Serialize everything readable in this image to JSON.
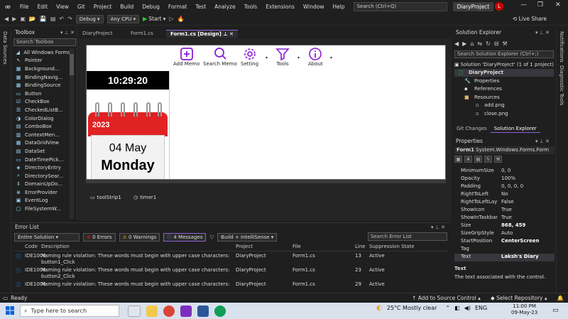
{
  "menu": {
    "items": [
      "File",
      "Edit",
      "View",
      "Git",
      "Project",
      "Build",
      "Debug",
      "Format",
      "Test",
      "Analyze",
      "Tools",
      "Extensions",
      "Window",
      "Help"
    ],
    "search_placeholder": "Search (Ctrl+Q)",
    "project_name": "DiaryProject",
    "avatar_letter": "L"
  },
  "toolbar": {
    "config": "Debug",
    "platform": "Any CPU",
    "start_label": "Start",
    "live_share": "Live Share"
  },
  "left_strip": {
    "label": "Data Sources"
  },
  "toolbox": {
    "title": "Toolbox",
    "search_placeholder": "Search Toolbox",
    "group": "All Windows Forms",
    "items": [
      "Pointer",
      "Background...",
      "BindingNavig...",
      "BindingSource",
      "Button",
      "CheckBox",
      "CheckedListB...",
      "ColorDialog",
      "ComboBox",
      "ContextMen...",
      "DataGridView",
      "DataSet",
      "DateTimePick...",
      "DirectoryEntry",
      "DirectorySear...",
      "DomainUpDo...",
      "ErrorProvider",
      "EventLog",
      "FileSystemW..."
    ]
  },
  "doc_tabs": [
    {
      "label": "DiaryProject"
    },
    {
      "label": "Form1.cs"
    },
    {
      "label": "Form1.cs [Design]"
    }
  ],
  "form": {
    "time": "10:29:20",
    "year": "2023",
    "date": "04 May",
    "day": "Monday",
    "toolstrip": [
      {
        "label": "Add Memo"
      },
      {
        "label": "Search Memo"
      },
      {
        "label": "Setting"
      },
      {
        "label": "Tools"
      },
      {
        "label": "About"
      }
    ],
    "accent_color": "#8a1bd6",
    "calendar_color": "#e02222"
  },
  "tray_components": [
    "toolStrip1",
    "timer1"
  ],
  "solution_explorer": {
    "title": "Solution Explorer",
    "search_placeholder": "Search Solution Explorer (Ctrl+;)",
    "rows": [
      "Solution 'DiaryProject' (1 of 1 project)",
      "DiaryProject",
      "Properties",
      "References",
      "Resources",
      "add.png",
      "close.png"
    ],
    "tabs": [
      "Git Changes",
      "Solution Explorer"
    ]
  },
  "right_strip": {
    "labels": [
      "Notifications",
      "Diagnostic Tools"
    ]
  },
  "properties": {
    "title": "Properties",
    "object": "Form1",
    "object_type": "System.Windows.Forms.Form",
    "rows": [
      {
        "name": "MinimumSize",
        "value": "0, 0"
      },
      {
        "name": "Opacity",
        "value": "100%"
      },
      {
        "name": "Padding",
        "value": "0, 0, 0, 0"
      },
      {
        "name": "RightToLeft",
        "value": "No"
      },
      {
        "name": "RightToLeftLayout",
        "value": "False"
      },
      {
        "name": "ShowIcon",
        "value": "True"
      },
      {
        "name": "ShowInTaskbar",
        "value": "True"
      },
      {
        "name": "Size",
        "value": "868, 459"
      },
      {
        "name": "SizeGripStyle",
        "value": "Auto"
      },
      {
        "name": "StartPosition",
        "value": "CenterScreen"
      },
      {
        "name": "Tag",
        "value": ""
      },
      {
        "name": "Text",
        "value": "Laksh's Diary"
      }
    ],
    "desc_title": "Text",
    "desc_text": "The text associated with the control."
  },
  "error_list": {
    "title": "Error List",
    "scope": "Entire Solution",
    "errors": "0 Errors",
    "warnings": "0 Warnings",
    "messages": "4 Messages",
    "build_filter": "Build + IntelliSense",
    "search_placeholder": "Search Error List",
    "columns": [
      "Code",
      "Description",
      "Project",
      "File",
      "Line",
      "Suppression State"
    ],
    "rows": [
      {
        "code": "IDE1006",
        "desc": "Naming rule violation: These words must begin with upper case characters: button1_Click",
        "project": "DiaryProject",
        "file": "Form1.cs",
        "line": "13",
        "state": "Active"
      },
      {
        "code": "IDE1006",
        "desc": "Naming rule violation: These words must begin with upper case characters: button2_Click",
        "project": "DiaryProject",
        "file": "Form1.cs",
        "line": "23",
        "state": "Active"
      },
      {
        "code": "IDE1006",
        "desc": "Naming rule violation: These words must begin with upper case characters: timer1_Tick",
        "project": "DiaryProject",
        "file": "Form1.cs",
        "line": "29",
        "state": "Active"
      }
    ]
  },
  "statusbar": {
    "ready": "Ready",
    "source_control": "Add to Source Control",
    "repository": "Select Repository"
  },
  "taskbar": {
    "search_placeholder": "Type here to search",
    "weather": "25°C  Mostly clear",
    "language": "ENG",
    "time": "11:00 PM",
    "date": "09-May-23"
  }
}
